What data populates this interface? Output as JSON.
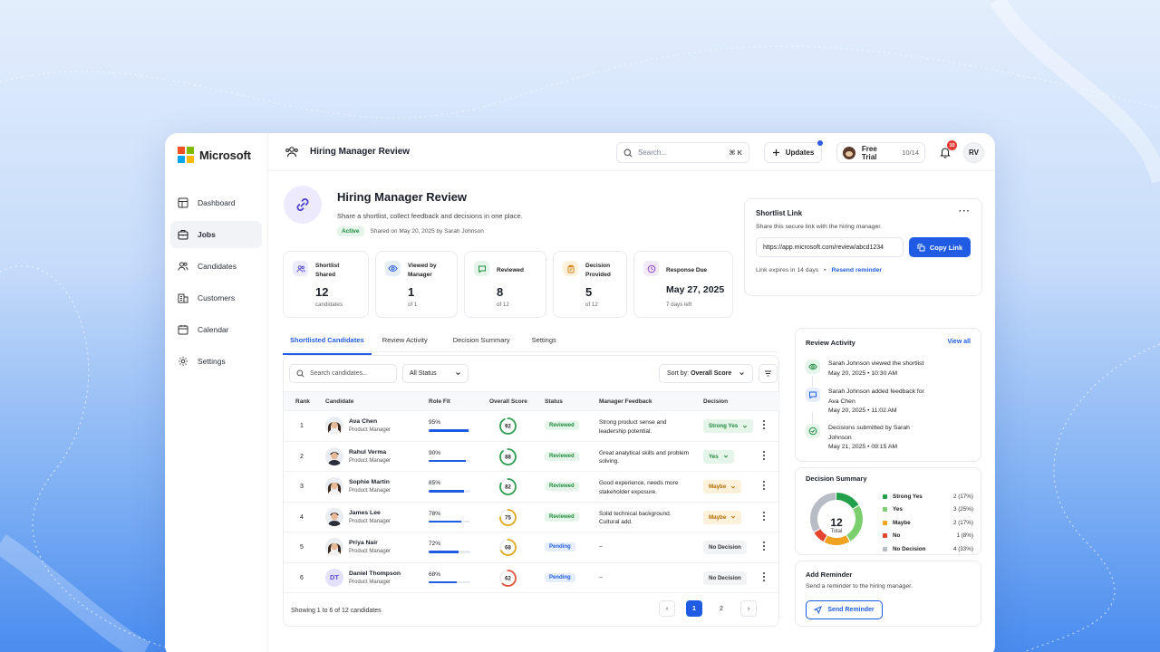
{
  "app": {
    "brand": "Microsoft",
    "colors": {
      "accent": "#1f5ce3",
      "success": "#1b8a3a",
      "warning": "#b36b00"
    }
  },
  "sidebar": {
    "items": [
      {
        "label": "Dashboard",
        "icon": "dashboard-icon"
      },
      {
        "label": "Jobs",
        "icon": "briefcase-icon"
      },
      {
        "label": "Candidates",
        "icon": "users-icon"
      },
      {
        "label": "Customers",
        "icon": "building-icon"
      },
      {
        "label": "Calendar",
        "icon": "calendar-icon"
      },
      {
        "label": "Settings",
        "icon": "gear-icon"
      }
    ]
  },
  "topbar": {
    "title": "Hiring Manager Review",
    "search_placeholder": "Search...",
    "search_shortcut": "⌘ K",
    "updates_label": "Updates",
    "trial_label": "Free Trial",
    "trial_count": "10/14",
    "notifications_count": "10",
    "user_initials": "RV"
  },
  "header": {
    "title": "Hiring Manager Review",
    "subtitle": "Share a shortlist, collect feedback and decisions in one place.",
    "status": "Active",
    "shared_info": "Shared on May 20, 2025 by Sarah Johnson"
  },
  "stats": [
    {
      "label": "Shortlist Shared",
      "value": "12",
      "sub": "candidates"
    },
    {
      "label": "Viewed by Manager",
      "value": "1",
      "sub": "of 1"
    },
    {
      "label": "Reviewed",
      "value": "8",
      "sub": "of 12"
    },
    {
      "label": "Decision Provided",
      "value": "5",
      "sub": "of 12"
    },
    {
      "label": "Response Due",
      "value": "May 27, 2025",
      "sub": "7 days left"
    }
  ],
  "shortlist_link": {
    "title": "Shortlist Link",
    "subtitle": "Share this secure link with the hiring manager.",
    "url": "https://app.microsoft.com/review/abcd1234",
    "copy_label": "Copy Link",
    "expiry": "Link expires in 14 days",
    "separator": "•",
    "resend_label": "Resend reminder"
  },
  "tabs": [
    {
      "label": "Shortlisted Candidates"
    },
    {
      "label": "Review Activity"
    },
    {
      "label": "Decision Summary"
    },
    {
      "label": "Settings"
    }
  ],
  "table": {
    "search_placeholder": "Search candidates...",
    "filter_value": "All Status",
    "sort_prefix": "Sort by:",
    "sort_value": "Overall Score",
    "columns": [
      "Rank",
      "Candidate",
      "Role Fit",
      "Overall Score",
      "Status",
      "Manager Feedback",
      "Decision"
    ],
    "rows": [
      {
        "rank": "1",
        "name": "Ava Chen",
        "role": "Product Manager",
        "fit": "95%",
        "fit_value": 95,
        "score": "92",
        "score_value": 92,
        "score_color": "#2e9e4f",
        "status": "Reviewed",
        "status_type": "reviewed",
        "feedback": "Strong product sense and leadership potential.",
        "decision": "Strong Yes",
        "decision_type": "strong",
        "has_dropdown": true,
        "avatar": "woman"
      },
      {
        "rank": "2",
        "name": "Rahul Verma",
        "role": "Product Manager",
        "fit": "90%",
        "fit_value": 90,
        "score": "88",
        "score_value": 88,
        "score_color": "#2e9e4f",
        "status": "Reviewed",
        "status_type": "reviewed",
        "feedback": "Great analytical skills and problem solving.",
        "decision": "Yes",
        "decision_type": "yes",
        "has_dropdown": true,
        "avatar": "man"
      },
      {
        "rank": "3",
        "name": "Sophie Martin",
        "role": "Product Manager",
        "fit": "85%",
        "fit_value": 85,
        "score": "82",
        "score_value": 82,
        "score_color": "#2e9e4f",
        "status": "Reviewed",
        "status_type": "reviewed",
        "feedback": "Good experience, needs more stakeholder exposure.",
        "decision": "Maybe",
        "decision_type": "maybe",
        "has_dropdown": true,
        "avatar": "woman"
      },
      {
        "rank": "4",
        "name": "James Lee",
        "role": "Product Manager",
        "fit": "78%",
        "fit_value": 78,
        "score": "75",
        "score_value": 75,
        "score_color": "#e0a81a",
        "status": "Reviewed",
        "status_type": "reviewed",
        "feedback": "Solid technical background. Cultural add.",
        "decision": "Maybe",
        "decision_type": "maybe",
        "has_dropdown": true,
        "avatar": "man"
      },
      {
        "rank": "5",
        "name": "Priya Nair",
        "role": "Product Manager",
        "fit": "72%",
        "fit_value": 72,
        "score": "68",
        "score_value": 68,
        "score_color": "#e0a81a",
        "status": "Pending",
        "status_type": "pending",
        "feedback": "–",
        "decision": "No Decision",
        "decision_type": "none",
        "has_dropdown": false,
        "avatar": "woman"
      },
      {
        "rank": "6",
        "name": "Daniel Thompson",
        "role": "Product Manager",
        "fit": "68%",
        "fit_value": 68,
        "score": "62",
        "score_value": 62,
        "score_color": "#e0543a",
        "status": "Pending",
        "status_type": "pending",
        "feedback": "–",
        "decision": "No Decision",
        "decision_type": "none",
        "has_dropdown": false,
        "avatar": "initials",
        "initials": "DT"
      }
    ],
    "footer": "Showing 1 to 6 of 12 candidates",
    "pages": [
      "1",
      "2"
    ],
    "prev": "‹",
    "next": "›"
  },
  "review_activity": {
    "title": "Review Activity",
    "view_all": "View all",
    "items": [
      {
        "text": "Sarah Johnson viewed the shortlist",
        "time": "May 20, 2025 • 10:30 AM",
        "icon": "eye-icon"
      },
      {
        "text": "Sarah Johnson added feedback for Ava Chen",
        "time": "May 20, 2025 • 11:02 AM",
        "icon": "comment-icon"
      },
      {
        "text": "Decisions submitted by Sarah Johnson",
        "time": "May 21, 2025 • 09:15 AM",
        "icon": "check-circle-icon"
      }
    ]
  },
  "decision_summary": {
    "title": "Decision Summary",
    "total": "12",
    "total_label": "Total",
    "items": [
      {
        "label": "Strong Yes",
        "value": "2 (17%)",
        "count": 2,
        "color": "#23a04a"
      },
      {
        "label": "Yes",
        "value": "3 (25%)",
        "count": 3,
        "color": "#7ccf6f"
      },
      {
        "label": "Maybe",
        "value": "2 (17%)",
        "count": 2,
        "color": "#f0a221"
      },
      {
        "label": "No",
        "value": "1 (8%)",
        "count": 1,
        "color": "#e5452f"
      },
      {
        "label": "No Decision",
        "value": "4 (33%)",
        "count": 4,
        "color": "#b8bcc5"
      }
    ]
  },
  "reminder": {
    "title": "Add Reminder",
    "subtitle": "Send a reminder to the hiring manager.",
    "button_label": "Send Reminder"
  }
}
